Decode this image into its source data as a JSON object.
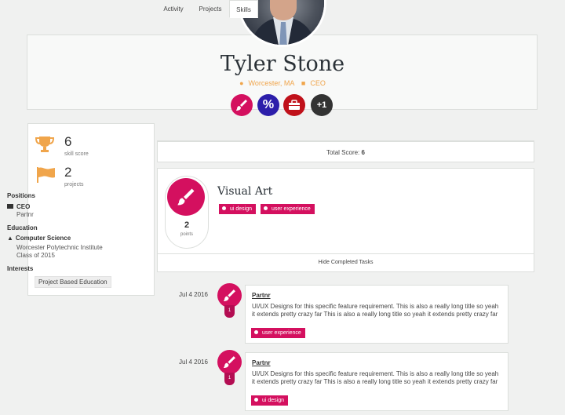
{
  "profile": {
    "name": "Tyler Stone",
    "location": "Worcester, MA",
    "role": "CEO",
    "badges": [
      {
        "icon": "paintbrush-icon",
        "color": "#d4105f"
      },
      {
        "icon": "percent-icon",
        "color": "#2c1eaa",
        "text": "%"
      },
      {
        "icon": "briefcase-icon",
        "color": "#c0111a"
      },
      {
        "icon": "more-badges-icon",
        "color": "#333333",
        "text": "+1"
      }
    ]
  },
  "sidebar": {
    "skill_score": "6",
    "skill_score_label": "skill score",
    "projects": "2",
    "projects_label": "projects",
    "positions_heading": "Positions",
    "position_title": "CEO",
    "position_company": "Partnr",
    "education_heading": "Education",
    "education_field": "Computer Science",
    "education_school": "Worcester Polytechnic Institute",
    "education_class": "Class of 2015",
    "interests_heading": "Interests",
    "interest_1": "Project Based Education"
  },
  "tabs": [
    "Activity",
    "Projects",
    "Skills"
  ],
  "score": {
    "label": "Total Score:",
    "value": "6"
  },
  "skill": {
    "title": "Visual Art",
    "points": "2",
    "points_label": "points",
    "tags": [
      "ui design",
      "user experience"
    ],
    "hide_label": "Hide Completed Tasks"
  },
  "timeline": [
    {
      "date": "Jul 4 2016",
      "count": "1",
      "title": "Partnr",
      "desc": "UI/UX Designs for this specific feature requirement. This is also a really long title so yeah it extends pretty crazy far This is also a really long title so yeah it extends pretty crazy far",
      "tag": "user experience"
    },
    {
      "date": "Jul 4 2016",
      "count": "1",
      "title": "Partnr",
      "desc": "UI/UX Designs for this specific feature requirement. This is also a really long title so yeah it extends pretty crazy far This is also a really long title so yeah it extends pretty crazy far",
      "tag": "ui design"
    }
  ],
  "colors": {
    "accent": "#d4105f",
    "meta": "#f0a54b",
    "trophy": "#f0a54b"
  }
}
